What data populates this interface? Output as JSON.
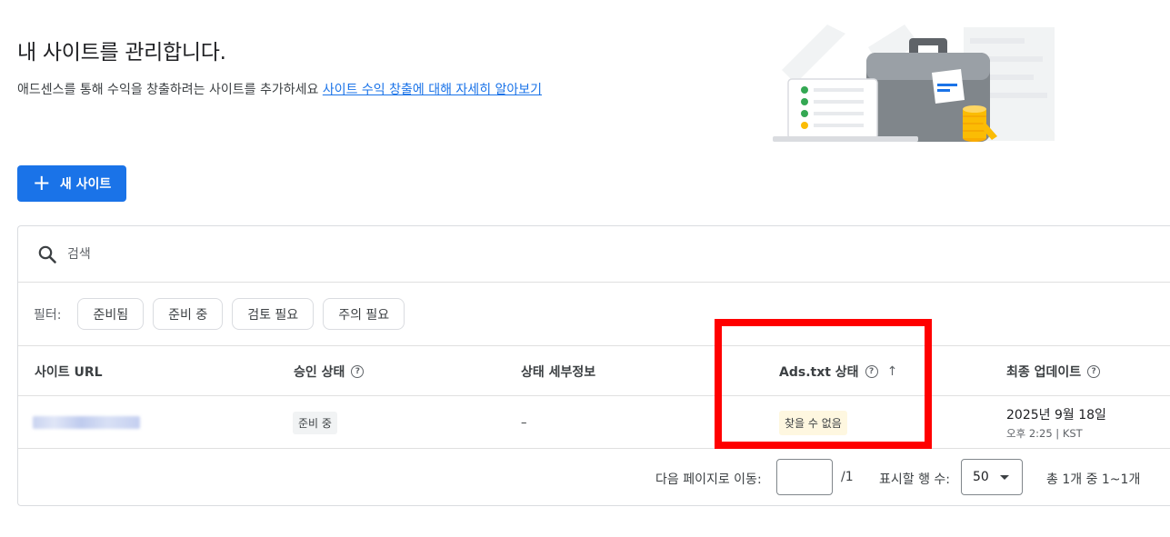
{
  "header": {
    "title": "내 사이트를 관리합니다.",
    "subtitle": "애드센스를 통해 수익을 창출하려는 사이트를 추가하세요",
    "learn_more_link": "사이트 수익 창출에 대해 자세히 알아보기"
  },
  "actions": {
    "new_site_label": "새 사이트",
    "new_site_icon": "plus-icon"
  },
  "search": {
    "icon": "search-icon",
    "placeholder": "검색"
  },
  "filters": {
    "label": "필터:",
    "chips": [
      "준비됨",
      "준비 중",
      "검토 필요",
      "주의 필요"
    ]
  },
  "table": {
    "columns": {
      "site_url": "사이트 URL",
      "approval_status": "승인 상태",
      "status_details": "상태 세부정보",
      "ads_txt_status": "Ads.txt 상태",
      "last_updated": "최종 업데이트"
    },
    "rows": [
      {
        "site_url": "",
        "approval_status": "준비 중",
        "status_details": "–",
        "ads_txt_status": "찾을 수 없음",
        "last_updated_date": "2025년 9월 18일",
        "last_updated_time": "오후 2:25 | KST"
      }
    ]
  },
  "pagination": {
    "goto_label": "다음 페이지로 이동:",
    "page_value": "",
    "total_pages": "/1",
    "rows_label": "표시할 행 수:",
    "rows_value": "50",
    "summary": "총 1개 중 1~1개"
  },
  "colors": {
    "primary": "#1a73e8",
    "highlight": "#ff0000",
    "warning_bg": "#fef7e0"
  }
}
